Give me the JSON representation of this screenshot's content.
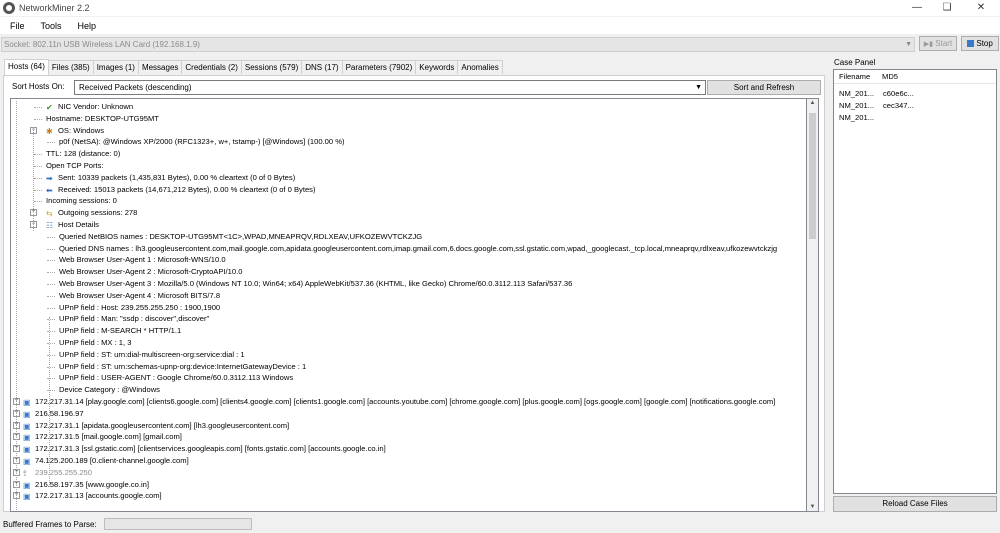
{
  "window": {
    "title": "NetworkMiner 2.2"
  },
  "menu": [
    "File",
    "Tools",
    "Help"
  ],
  "toolbar": {
    "socket": "Socket: 802.11n USB Wireless LAN Card (192.168.1.9)",
    "start_label": "Start",
    "stop_label": "Stop"
  },
  "tabs": [
    {
      "label": "Hosts (64)",
      "active": true
    },
    {
      "label": "Files (385)"
    },
    {
      "label": "Images (1)"
    },
    {
      "label": "Messages"
    },
    {
      "label": "Credentials (2)"
    },
    {
      "label": "Sessions (579)"
    },
    {
      "label": "DNS (17)"
    },
    {
      "label": "Parameters (7902)"
    },
    {
      "label": "Keywords"
    },
    {
      "label": "Anomalies"
    }
  ],
  "sort": {
    "label": "Sort Hosts On:",
    "value": "Received Packets (descending)",
    "button": "Sort and Refresh"
  },
  "tree": [
    {
      "text": "NIC Vendor: Unknown",
      "level": 2,
      "icon": "check-icon"
    },
    {
      "text": "Hostname: DESKTOP-UTG95MT",
      "level": 2
    },
    {
      "text": "OS: Windows",
      "level": 2,
      "icon": "os-icon",
      "expander": "−"
    },
    {
      "text": "p0f (NetSA): @Windows XP/2000 (RFC1323+, w+, tstamp-) [@Windows] (100.00 %)",
      "level": 3
    },
    {
      "text": "TTL: 128 (distance: 0)",
      "level": 2
    },
    {
      "text": "Open TCP Ports:",
      "level": 2
    },
    {
      "text": "Sent: 10339 packets (1,435,831 Bytes), 0.00 % cleartext (0 of 0 Bytes)",
      "level": 2,
      "icon": "sent-arrow-icon"
    },
    {
      "text": "Received: 15013 packets (14,671,212 Bytes), 0.00 % cleartext (0 of 0 Bytes)",
      "level": 2,
      "icon": "received-arrow-icon"
    },
    {
      "text": "Incoming sessions: 0",
      "level": 2
    },
    {
      "text": "Outgoing sessions: 278",
      "level": 2,
      "icon": "sessions-icon",
      "expander": "+"
    },
    {
      "text": "Host Details",
      "level": 2,
      "icon": "details-icon",
      "expander": "−"
    },
    {
      "text": "Queried NetBIOS names : DESKTOP-UTG95MT<1C>,WPAD,MNEAPRQV,RDLXEAV,UFKOZEWVTCKZJG",
      "level": 3
    },
    {
      "text": "Queried DNS names : lh3.googleusercontent.com,mail.google.com,apidata.googleusercontent.com,imap.gmail.com,6.docs.google.com,ssl.gstatic.com,wpad,_googlecast._tcp.local,mneaprqv,rdlxeav,ufkozewvtckzjg",
      "level": 3
    },
    {
      "text": "Web Browser User-Agent 1 : Microsoft-WNS/10.0",
      "level": 3
    },
    {
      "text": "Web Browser User-Agent 2 : Microsoft-CryptoAPI/10.0",
      "level": 3
    },
    {
      "text": "Web Browser User-Agent 3 : Mozilla/5.0 (Windows NT 10.0; Win64; x64) AppleWebKit/537.36 (KHTML, like Gecko) Chrome/60.0.3112.113 Safari/537.36",
      "level": 3
    },
    {
      "text": "Web Browser User-Agent 4 : Microsoft BITS/7.8",
      "level": 3
    },
    {
      "text": "UPnP field : Host: 239.255.255.250 : 1900,1900",
      "level": 3
    },
    {
      "text": "UPnP field : Man: \"ssdp : discover\",discover\"",
      "level": 3
    },
    {
      "text": "UPnP field : M-SEARCH * HTTP/1.1",
      "level": 3
    },
    {
      "text": "UPnP field : MX : 1, 3",
      "level": 3
    },
    {
      "text": "UPnP field : ST: urn:dial-multiscreen-org:service:dial : 1",
      "level": 3
    },
    {
      "text": "UPnP field : ST: urn:schemas-upnp-org:device:InternetGatewayDevice : 1",
      "level": 3
    },
    {
      "text": "UPnP field : USER-AGENT : Google Chrome/60.0.3112.113 Windows",
      "level": 3
    },
    {
      "text": "Device Category : @Windows",
      "level": 3
    },
    {
      "text": "172.217.31.14 [play.google.com] [clients6.google.com] [clients4.google.com] [clients1.google.com] [accounts.youtube.com] [chrome.google.com] [plus.google.com] [ogs.google.com] [google.com] [notifications.google.com]",
      "level": 0,
      "icon": "host-icon",
      "expander": "+"
    },
    {
      "text": "216.58.196.97",
      "level": 0,
      "icon": "host-icon",
      "expander": "+"
    },
    {
      "text": "172.217.31.1 [apidata.googleusercontent.com] [lh3.googleusercontent.com]",
      "level": 0,
      "icon": "host-icon",
      "expander": "+"
    },
    {
      "text": "172.217.31.5 [mail.google.com] [gmail.com]",
      "level": 0,
      "icon": "host-icon",
      "expander": "+"
    },
    {
      "text": "172.217.31.3 [ssl.gstatic.com] [clientservices.googleapis.com] [fonts.gstatic.com] [accounts.google.co.in]",
      "level": 0,
      "icon": "host-icon",
      "expander": "+"
    },
    {
      "text": "74.125.200.189 [0.client-channel.google.com]",
      "level": 0,
      "icon": "host-icon",
      "expander": "+"
    },
    {
      "text": "239.255.255.250",
      "level": 0,
      "icon": "multicast-icon",
      "expander": "+",
      "gray": true
    },
    {
      "text": "216.58.197.35 [www.google.co.in]",
      "level": 0,
      "icon": "host-icon",
      "expander": "+"
    },
    {
      "text": "172.217.31.13 [accounts.google.com]",
      "level": 0,
      "icon": "host-icon",
      "expander": "+"
    }
  ],
  "case_panel": {
    "title": "Case Panel",
    "col_filename": "Filename",
    "col_md5": "MD5",
    "rows": [
      {
        "filename": "NM_201...",
        "md5": "c60e6c..."
      },
      {
        "filename": "NM_201...",
        "md5": "cec347..."
      },
      {
        "filename": "NM_201...",
        "md5": ""
      }
    ],
    "reload_label": "Reload Case Files"
  },
  "status": {
    "buffered_label": "Buffered Frames to Parse:"
  }
}
